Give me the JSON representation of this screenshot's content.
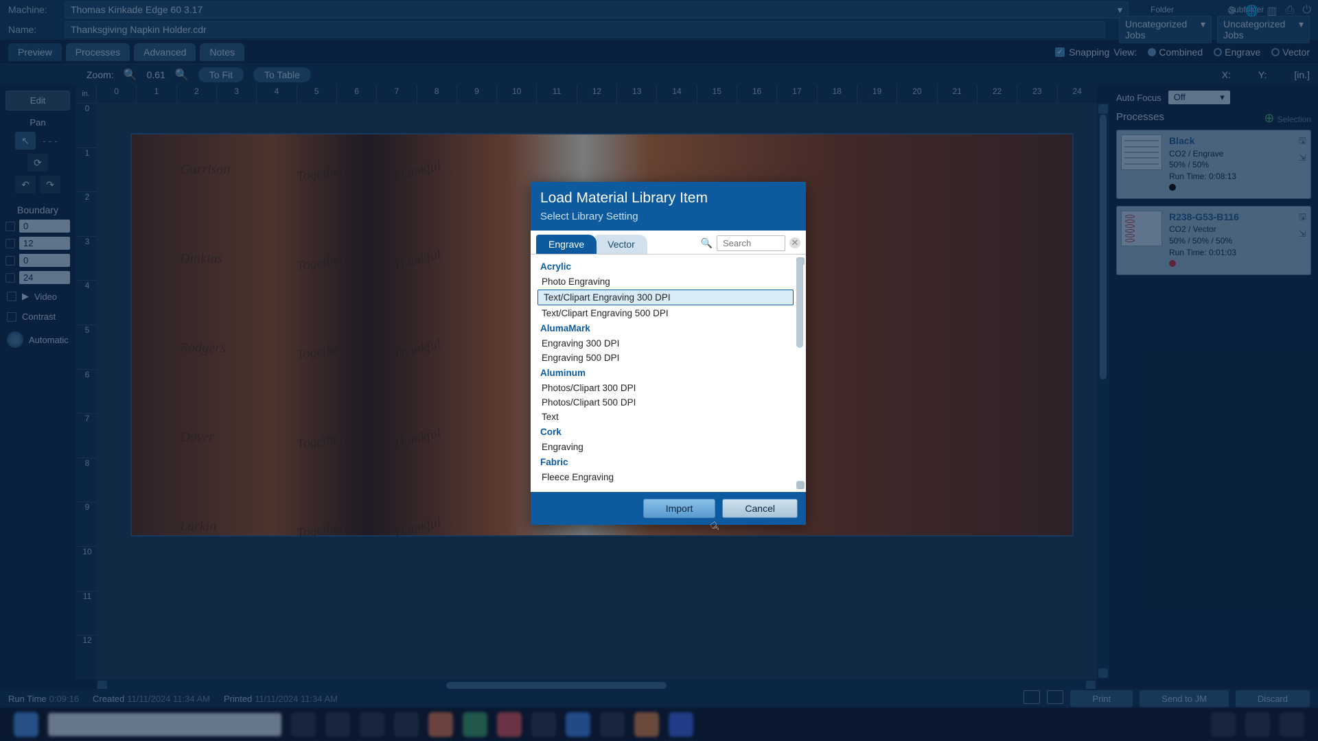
{
  "header": {
    "machine_label": "Machine:",
    "machine_value": "Thomas Kinkade Edge 60 3.17",
    "name_label": "Name:",
    "name_value": "Thanksgiving Napkin Holder.cdr",
    "folder_label": "Folder",
    "subfolder_label": "Subfolder",
    "folder_value": "Uncategorized Jobs",
    "subfolder_value": "Uncategorized Jobs"
  },
  "tabs": {
    "preview": "Preview",
    "processes": "Processes",
    "advanced": "Advanced",
    "notes": "Notes",
    "snapping": "Snapping",
    "view_label": "View:",
    "combined": "Combined",
    "engrave": "Engrave",
    "vector": "Vector"
  },
  "zoom": {
    "label": "Zoom:",
    "value": "0.61",
    "to_fit": "To Fit",
    "to_table": "To Table",
    "x_label": "X:",
    "y_label": "Y:",
    "unit": "[in.]"
  },
  "left": {
    "edit": "Edit",
    "pan": "Pan",
    "dashes": "- - -",
    "boundary": "Boundary",
    "b0": "0",
    "b1": "12",
    "b2": "0",
    "b3": "24",
    "video": "Video",
    "contrast": "Contrast",
    "automatic": "Automatic"
  },
  "ruler": {
    "corner": "in.",
    "h": [
      "0",
      "1",
      "2",
      "3",
      "4",
      "5",
      "6",
      "7",
      "8",
      "9",
      "10",
      "11",
      "12",
      "13",
      "14",
      "15",
      "16",
      "17",
      "18",
      "19",
      "20",
      "21",
      "22",
      "23",
      "24"
    ],
    "v": [
      "0",
      "1",
      "2",
      "3",
      "4",
      "5",
      "6",
      "7",
      "8",
      "9",
      "10",
      "11",
      "12"
    ]
  },
  "design": {
    "names": [
      "Garrison",
      "Dinkins",
      "Rodgers",
      "Dover",
      "Larkin"
    ],
    "word1": "Together",
    "word2": "Thankful"
  },
  "right": {
    "auto_focus": "Auto Focus",
    "af_value": "Off",
    "processes_hdr": "Processes",
    "selection": "Selection"
  },
  "processes": [
    {
      "name": "Black",
      "sub": "CO2 / Engrave",
      "vals": "50% / 50%",
      "run": "Run Time: 0:08:13",
      "dot": "black",
      "thumb": "raster"
    },
    {
      "name": "R238-G53-B116",
      "sub": "CO2 / Vector",
      "vals": "50% / 50% / 50%",
      "run": "Run Time: 0:01:03",
      "dot": "red",
      "thumb": "vector"
    }
  ],
  "footer": {
    "run_time_label": "Run Time",
    "run_time": "0:09:16",
    "created_label": "Created",
    "created": "11/11/2024 11:34 AM",
    "printed_label": "Printed",
    "printed": "11/11/2024 11:34 AM",
    "print": "Print",
    "send": "Send to JM",
    "discard": "Discard"
  },
  "modal": {
    "title": "Load Material Library Item",
    "subtitle": "Select Library Setting",
    "tab_engrave": "Engrave",
    "tab_vector": "Vector",
    "search_placeholder": "Search",
    "import": "Import",
    "cancel": "Cancel",
    "list": [
      {
        "type": "cat",
        "label": "Acrylic"
      },
      {
        "type": "item",
        "label": "Photo Engraving"
      },
      {
        "type": "item",
        "label": "Text/Clipart Engraving 300 DPI",
        "selected": true
      },
      {
        "type": "item",
        "label": "Text/Clipart Engraving 500 DPI"
      },
      {
        "type": "cat",
        "label": "AlumaMark"
      },
      {
        "type": "item",
        "label": "Engraving 300 DPI"
      },
      {
        "type": "item",
        "label": "Engraving 500 DPI"
      },
      {
        "type": "cat",
        "label": "Aluminum"
      },
      {
        "type": "item",
        "label": "Photos/Clipart 300 DPI"
      },
      {
        "type": "item",
        "label": "Photos/Clipart 500 DPI"
      },
      {
        "type": "item",
        "label": "Text"
      },
      {
        "type": "cat",
        "label": "Cork"
      },
      {
        "type": "item",
        "label": "Engraving"
      },
      {
        "type": "cat",
        "label": "Fabric"
      },
      {
        "type": "item",
        "label": "Fleece Engraving"
      }
    ]
  }
}
